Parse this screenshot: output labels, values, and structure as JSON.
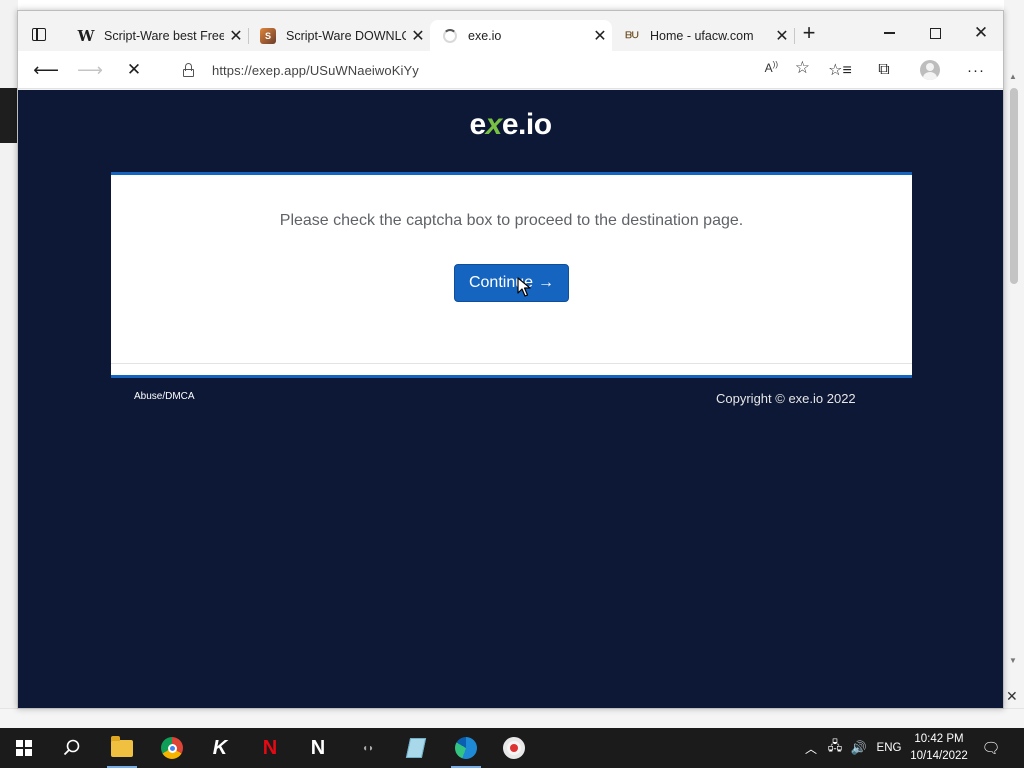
{
  "browser": {
    "tabs": [
      {
        "title": "Script-Ware best Free",
        "favicon": "wiki-w-icon",
        "active": false
      },
      {
        "title": "Script-Ware DOWNLO",
        "favicon": "script-ware-icon",
        "active": false
      },
      {
        "title": "exe.io",
        "favicon": "loading-spinner-icon",
        "active": true
      },
      {
        "title": "Home - ufacw.com",
        "favicon": "ufa-icon",
        "active": false
      }
    ],
    "url": "https://exep.app/USuWNaeiwoKiYy"
  },
  "page": {
    "logo": {
      "pre": "e",
      "x": "x",
      "post": "e.io"
    },
    "message": "Please check the captcha box to proceed to the destination page.",
    "continue_label": "Continue",
    "continue_arrow": "→",
    "footer_left": "Abuse/DMCA",
    "footer_right": "Copyright © exe.io 2022"
  },
  "taskbar": {
    "language": "ENG",
    "time": "10:42 PM",
    "date": "10/14/2022"
  },
  "colors": {
    "page_bg": "#0c1836",
    "accent": "#1565c0",
    "logo_green": "#79c142"
  }
}
